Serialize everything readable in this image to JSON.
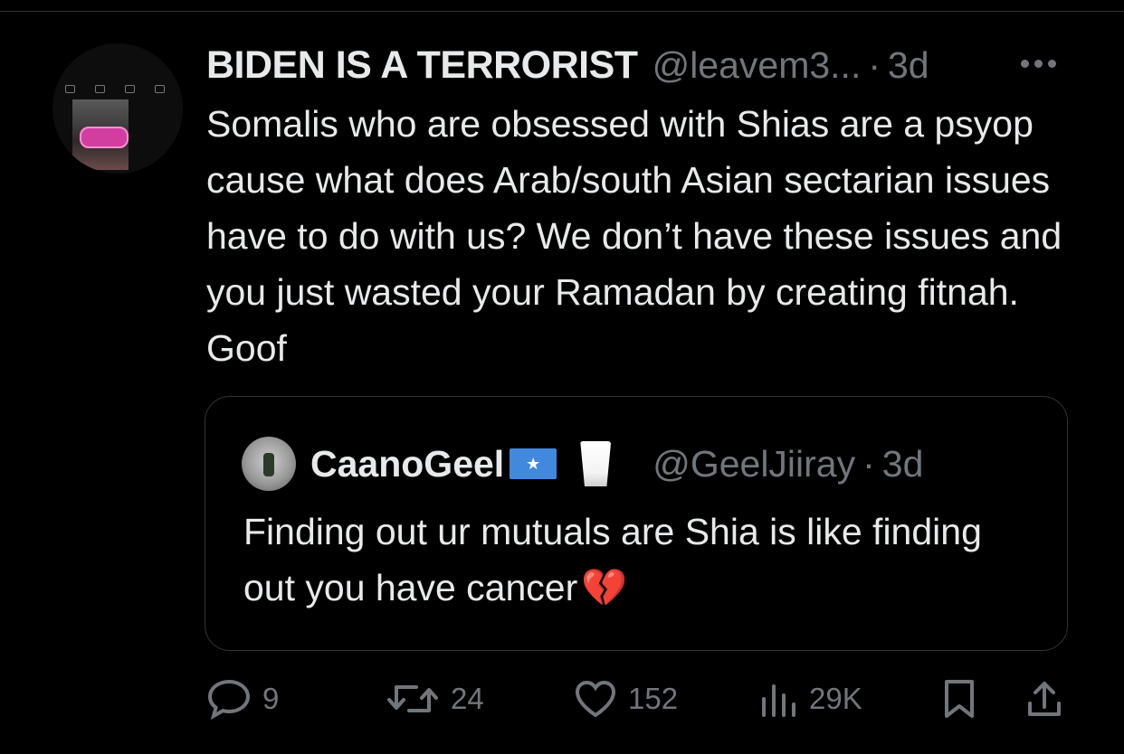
{
  "author": {
    "display_name": "BIDEN IS A TERRORIST",
    "handle": "@leavem3...",
    "separator": "·",
    "time": "3d"
  },
  "tweet_text": "Somalis who are obsessed with Shias are a psyop cause what does Arab/south Asian sectarian issues have to do with us? We don’t have these issues and you just wasted your Ramadan by creating fitnah. Goof",
  "quote": {
    "display_name": "CaanoGeel",
    "flag_star": "★",
    "handle": "@GeelJiiray",
    "separator": "·",
    "time": "3d",
    "text": "Finding out ur mutuals are Shia is like finding out you have cancer",
    "emoji": "💔"
  },
  "actions": {
    "replies": "9",
    "reposts": "24",
    "likes": "152",
    "views": "29K"
  },
  "icons": [
    "more-icon",
    "reply-icon",
    "repost-icon",
    "like-icon",
    "views-icon",
    "bookmark-icon",
    "share-icon"
  ],
  "colors": {
    "background": "#000000",
    "text": "#e7e9ea",
    "muted": "#71767b",
    "border": "#2f3336"
  }
}
